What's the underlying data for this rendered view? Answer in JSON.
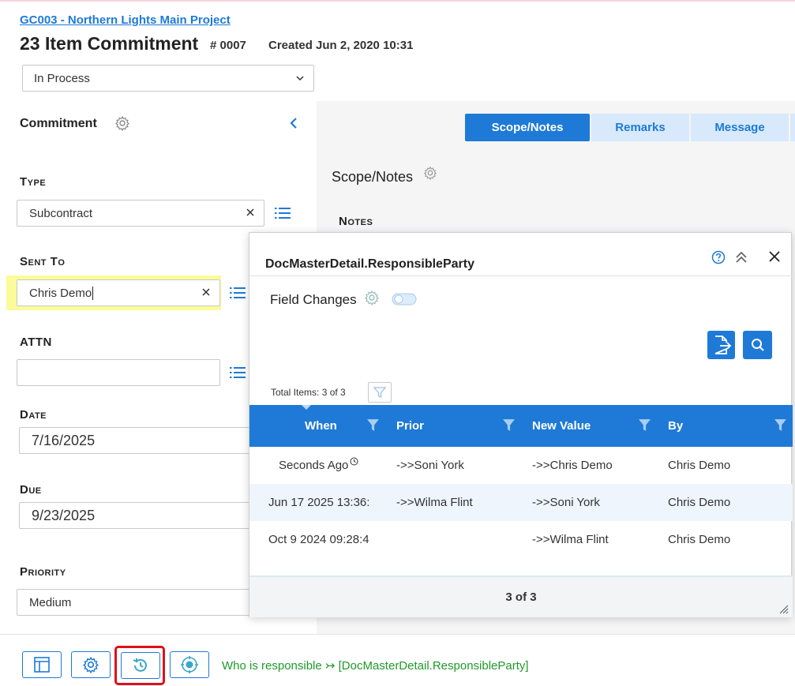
{
  "header": {
    "project_link": "GC003 - Northern Lights Main Project",
    "title": "23 Item Commitment",
    "doc_number": "# 0007",
    "created": "Created Jun 2, 2020 10:31",
    "status": "In Process"
  },
  "left_panel": {
    "title": "Commitment",
    "fields": {
      "type": {
        "label": "Type",
        "value": "Subcontract"
      },
      "sent_to": {
        "label": "Sent To",
        "value": "Chris Demo"
      },
      "attn": {
        "label": "ATTN",
        "value": ""
      },
      "date": {
        "label": "Date",
        "value": "7/16/2025"
      },
      "due": {
        "label": "Due",
        "value": "9/23/2025"
      },
      "priority": {
        "label": "Priority",
        "value": "Medium"
      }
    }
  },
  "tabs": [
    {
      "label": "Scope/Notes",
      "active": true
    },
    {
      "label": "Remarks",
      "active": false
    },
    {
      "label": "Message",
      "active": false
    }
  ],
  "scope": {
    "title": "Scope/Notes",
    "notes_label": "Notes"
  },
  "popup": {
    "title": "DocMasterDetail.ResponsibleParty",
    "section_title": "Field Changes",
    "total_items": "Total Items: 3 of 3",
    "columns": [
      "When",
      "Prior",
      "New Value",
      "By"
    ],
    "rows": [
      {
        "when": "Seconds Ago",
        "prior": "->>Soni York",
        "new_value": "->>Chris Demo",
        "by": "Chris Demo"
      },
      {
        "when": "Jun 17 2025 13:36:",
        "prior": "->>Wilma Flint",
        "new_value": "->>Soni York",
        "by": "Chris Demo"
      },
      {
        "when": "Oct 9 2024 09:28:4",
        "prior": "",
        "new_value": "->>Wilma Flint",
        "by": "Chris Demo"
      }
    ],
    "footer": "3 of 3"
  },
  "status_message": "Who is responsible ↣ [DocMasterDetail.ResponsibleParty]",
  "colors": {
    "accent": "#1e7ad6",
    "highlight": "#fbfb9a",
    "status_green": "#1f9a2a",
    "focus_red": "#e0101a"
  },
  "icons": [
    "gear-icon",
    "chevron-left-icon",
    "chevron-down-icon",
    "clear-icon",
    "list-icon",
    "help-icon",
    "expand-icon",
    "close-icon",
    "toggle-icon",
    "export-icon",
    "search-icon",
    "filter-icon",
    "clock-icon",
    "resize-grip-icon",
    "layout-icon",
    "history-icon",
    "target-icon"
  ]
}
